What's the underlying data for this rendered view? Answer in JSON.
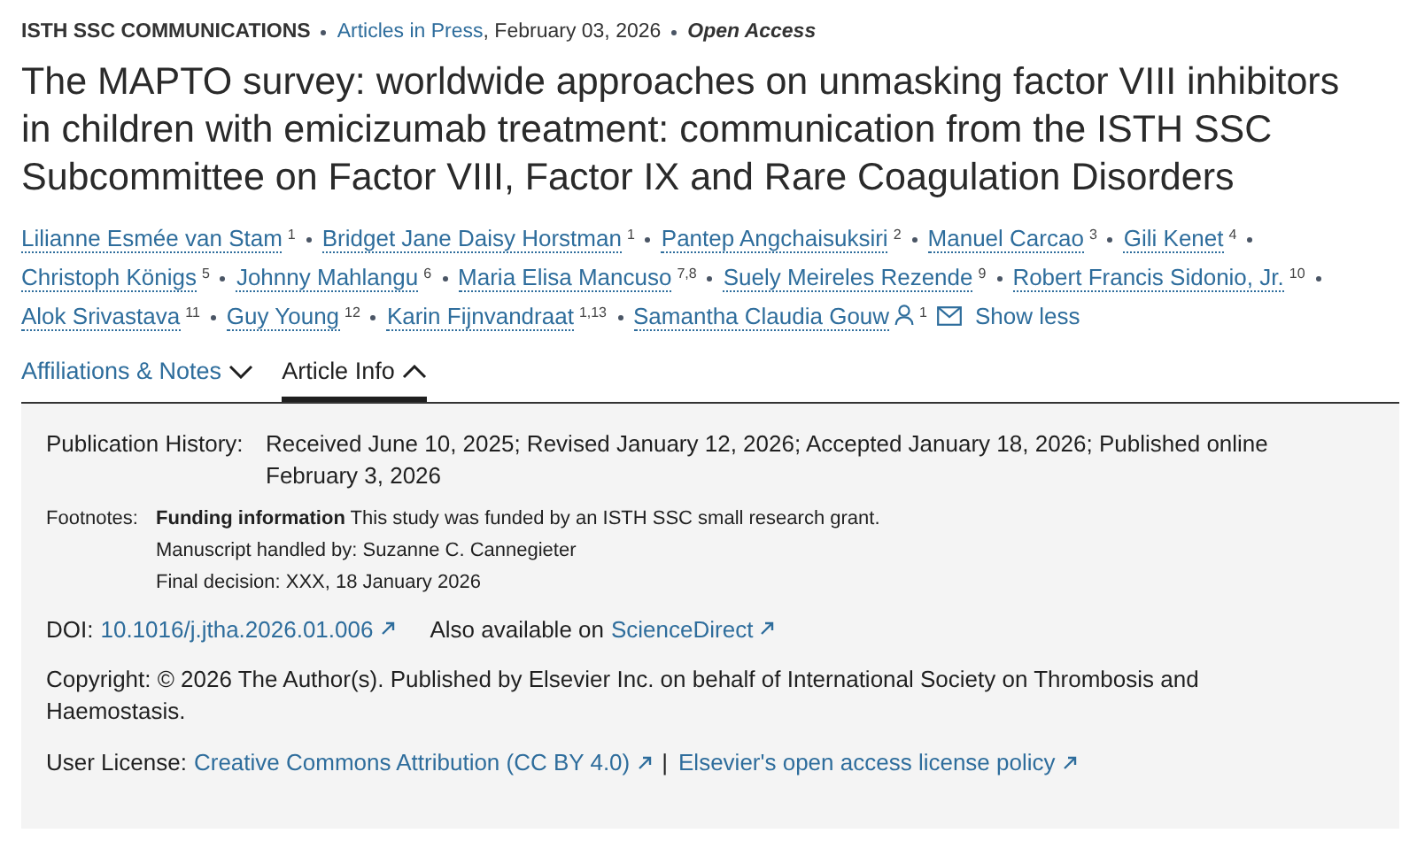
{
  "header": {
    "journal": "ISTH SSC COMMUNICATIONS",
    "section": "Articles in Press",
    "date": ", February 03, 2026",
    "access": "Open Access"
  },
  "title": "The MAPTO survey: worldwide approaches on unmasking factor VIII inhibitors in children with emicizumab treatment: communication from the ISTH SSC Subcommittee on Factor VIII, Factor IX and Rare Coagulation Disorders",
  "authors": [
    {
      "name": "Lilianne Esmée van Stam",
      "affiliation": "1",
      "corresponding": false
    },
    {
      "name": "Bridget Jane Daisy Horstman",
      "affiliation": "1",
      "corresponding": false
    },
    {
      "name": "Pantep Angchaisuksiri",
      "affiliation": "2",
      "corresponding": false
    },
    {
      "name": "Manuel Carcao",
      "affiliation": "3",
      "corresponding": false
    },
    {
      "name": "Gili Kenet",
      "affiliation": "4",
      "corresponding": false
    },
    {
      "name": "Christoph Königs",
      "affiliation": "5",
      "corresponding": false
    },
    {
      "name": "Johnny Mahlangu",
      "affiliation": "6",
      "corresponding": false
    },
    {
      "name": "Maria Elisa Mancuso",
      "affiliation": "7,8",
      "corresponding": false
    },
    {
      "name": "Suely Meireles Rezende",
      "affiliation": "9",
      "corresponding": false
    },
    {
      "name": "Robert Francis Sidonio, Jr.",
      "affiliation": "10",
      "corresponding": false
    },
    {
      "name": "Alok Srivastava",
      "affiliation": "11",
      "corresponding": false
    },
    {
      "name": "Guy Young",
      "affiliation": "12",
      "corresponding": false
    },
    {
      "name": "Karin Fijnvandraat",
      "affiliation": "1,13",
      "corresponding": false
    },
    {
      "name": "Samantha Claudia Gouw",
      "affiliation": "1",
      "corresponding": true
    }
  ],
  "show_less": "Show less",
  "tabs": [
    {
      "label": "Affiliations & Notes",
      "selected": false,
      "expanded": false
    },
    {
      "label": "Article Info",
      "selected": true,
      "expanded": true
    }
  ],
  "article_info": {
    "publication_history": {
      "label": "Publication History:",
      "value": "Received June 10, 2025; Revised January 12, 2026; Accepted January 18, 2026; Published online February 3, 2026"
    },
    "footnotes": {
      "label": "Footnotes:",
      "items": [
        "**Funding information** This study was funded by an ISTH SSC small research grant.",
        "Manuscript handled by: Suzanne C. Cannegieter",
        "Final decision: XXX, 18 January 2026"
      ]
    },
    "doi": {
      "label": "DOI:",
      "link": "10.1016/j.jtha.2026.01.006",
      "also_label": "Also available on",
      "also_link": "ScienceDirect"
    },
    "copyright": "Copyright: © 2026 The Author(s). Published by Elsevier Inc. on behalf of International Society on Thrombosis and Haemostasis.",
    "license": {
      "label": "User License:",
      "link": "Creative Commons Attribution (CC BY 4.0)",
      "separator": "|",
      "policy_link": "Elsevier's open access license policy"
    }
  }
}
